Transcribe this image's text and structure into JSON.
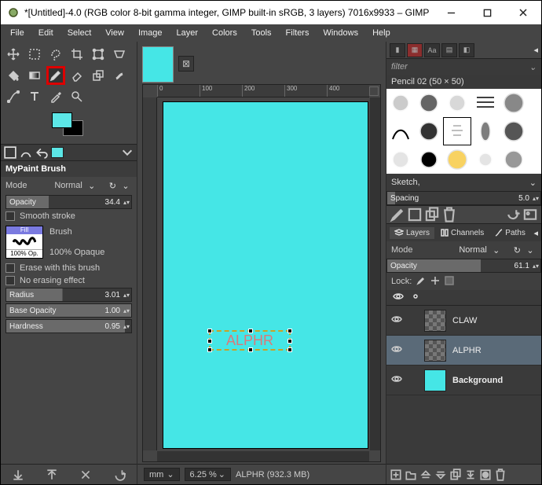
{
  "window": {
    "title": "*[Untitled]-4.0 (RGB color 8-bit gamma integer, GIMP built-in sRGB, 3 layers) 7016x9933 – GIMP",
    "menus": [
      "File",
      "Edit",
      "Select",
      "View",
      "Image",
      "Layer",
      "Colors",
      "Tools",
      "Filters",
      "Windows",
      "Help"
    ]
  },
  "toolOptions": {
    "title": "MyPaint Brush",
    "modeLabel": "Mode",
    "modeValue": "Normal",
    "opacityLabel": "Opacity",
    "opacityValue": "34.4",
    "smoothStroke": "Smooth stroke",
    "brushLabel": "Brush",
    "brushFill": "Fill",
    "brushOp": "100% Op.",
    "brushDesc": "100% Opaque",
    "eraseWith": "Erase with this brush",
    "noErasing": "No erasing effect",
    "radiusLabel": "Radius",
    "radiusValue": "3.01",
    "baseOpLabel": "Base Opacity",
    "baseOpValue": "1.00",
    "hardnessLabel": "Hardness",
    "hardnessValue": "0.95"
  },
  "canvas": {
    "rulerTicks": [
      "0",
      "100",
      "200",
      "300",
      "400"
    ],
    "selText": "ALPHR"
  },
  "status": {
    "unit": "mm",
    "zoom": "6.25 %",
    "msg": "ALPHR (932.3 MB)"
  },
  "brushes": {
    "filterPlaceholder": "filter",
    "currentLabel": "Pencil 02 (50 × 50)",
    "preset": "Sketch,",
    "spacingLabel": "Spacing",
    "spacingValue": "5.0"
  },
  "layers": {
    "tabs": [
      "Layers",
      "Channels",
      "Paths"
    ],
    "modeLabel": "Mode",
    "modeValue": "Normal",
    "opacityLabel": "Opacity",
    "opacityValue": "61.1",
    "lockLabel": "Lock:",
    "items": [
      {
        "name": "CLAW",
        "bg": false,
        "sel": false
      },
      {
        "name": "ALPHR",
        "bg": false,
        "sel": true
      },
      {
        "name": "Background",
        "bg": true,
        "sel": false
      }
    ]
  }
}
